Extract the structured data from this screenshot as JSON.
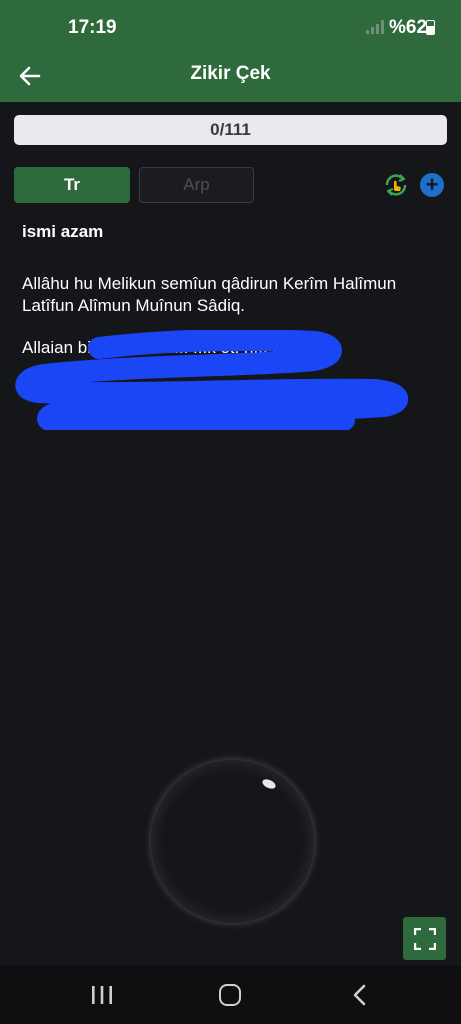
{
  "status_bar": {
    "time": "17:19",
    "battery": "%62"
  },
  "app_bar": {
    "title": "Zikir Çek"
  },
  "progress": {
    "label": "0/111",
    "current": 0,
    "target": 111
  },
  "tabs": [
    {
      "label": "Tr",
      "active": true
    },
    {
      "label": "Arp",
      "active": false
    }
  ],
  "zikir": {
    "name": "ismi azam",
    "text": "Allâhu hu Melikun semîun qâdirun Kerîm Halîmun Latîfun Alîmun Muînun Sâdiq.",
    "description_fragment": "Allaian bi... ...ilen be... ...k et. h... ...miz y..."
  },
  "colors": {
    "primary": "#2e6a3b",
    "background": "#15161a",
    "accent": "#1d6fc9",
    "redaction": "#1a46f5"
  },
  "icons": {
    "refresh": "refresh-hand-icon",
    "add": "plus-icon",
    "back": "arrow-left-icon",
    "fullscreen": "fullscreen-icon"
  }
}
